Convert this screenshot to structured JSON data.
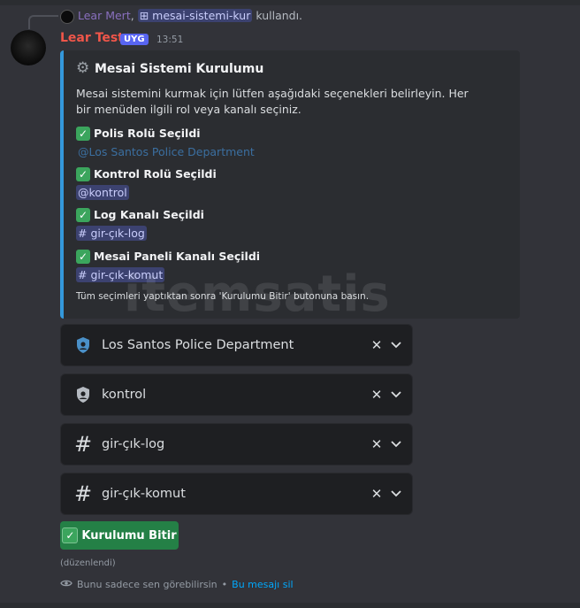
{
  "reply": {
    "user": "Lear Mert",
    "separator": ",",
    "command": "mesai-sistemi-kur",
    "action": "kullandı."
  },
  "message": {
    "author": "Lear Test",
    "badge": "UYG",
    "timestamp": "13:51",
    "edited": "(düzenlendi)"
  },
  "embed": {
    "accent_color": "#3498db",
    "title": "Mesai Sistemi Kurulumu",
    "description": "Mesai sistemini kurmak için lütfen aşağıdaki seçenekleri belirleyin. Her bir menüden ilgili rol veya kanalı seçiniz.",
    "fields": [
      {
        "name": "Polis Rolü Seçildi",
        "value": "@Los Santos Police Department"
      },
      {
        "name": "Kontrol Rolü Seçildi",
        "value": "@kontrol"
      },
      {
        "name": "Log Kanalı Seçildi",
        "value": "# gir-çık-log"
      },
      {
        "name": "Mesai Paneli Kanalı Seçildi",
        "value": "# gir-çık-komut"
      }
    ],
    "footer": "Tüm seçimleri yaptıktan sonra 'Kurulumu Bitir' butonuna basın."
  },
  "selects": [
    {
      "icon": "shield-icon",
      "label": "Los Santos Police Department"
    },
    {
      "icon": "shield-icon",
      "label": "kontrol"
    },
    {
      "icon": "hash-icon",
      "label": "gir-çık-log"
    },
    {
      "icon": "hash-icon",
      "label": "gir-çık-komut"
    }
  ],
  "button": {
    "label": "Kurulumu Bitir",
    "color": "#248046"
  },
  "ephemeral": {
    "notice": "Bunu sadece sen görebilirsin",
    "separator": "•",
    "link": "Bu mesajı sil"
  },
  "watermark": "itemsatis"
}
